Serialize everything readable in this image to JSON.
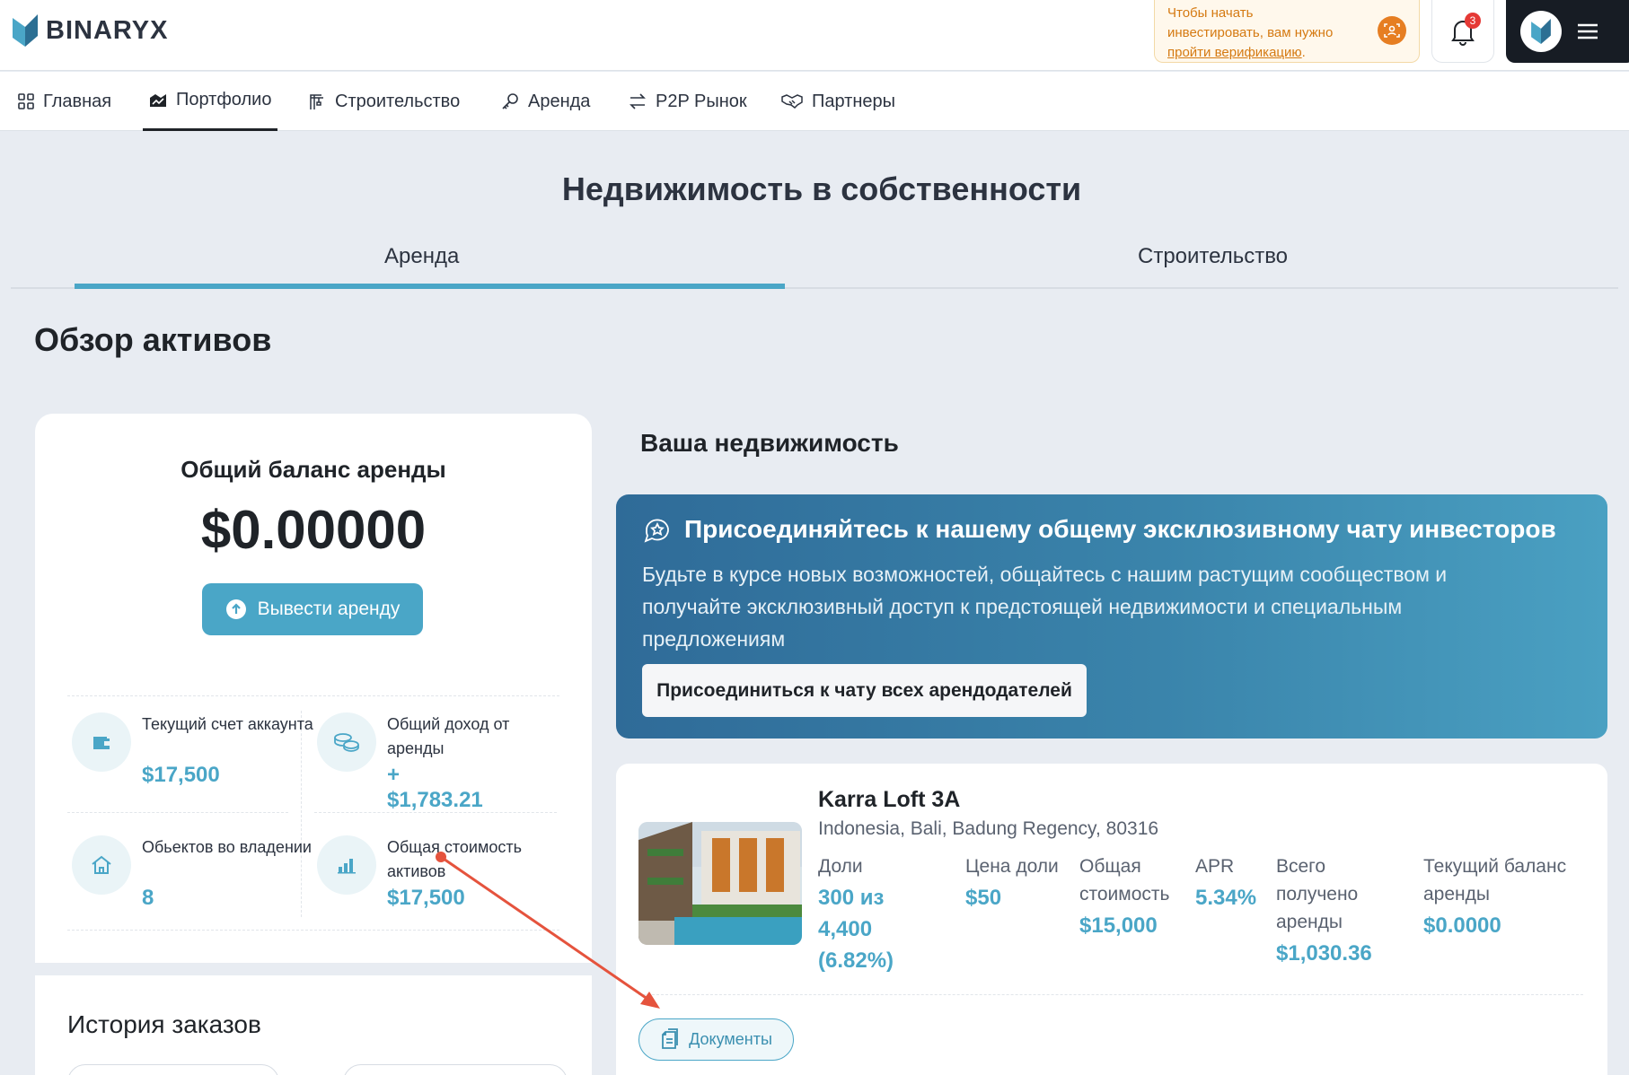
{
  "header": {
    "logo_text": "BINARYX",
    "verify_line1": "Чтобы начать",
    "verify_line2": "инвестировать, вам нужно",
    "verify_link": "пройти верификацию",
    "verify_tail": ".",
    "notifications_count": "3"
  },
  "nav": [
    {
      "label": "Главная",
      "icon": "grid-icon"
    },
    {
      "label": "Портфолио",
      "icon": "chart-icon"
    },
    {
      "label": "Строительство",
      "icon": "crane-icon"
    },
    {
      "label": "Аренда",
      "icon": "key-icon"
    },
    {
      "label": "P2P Рынок",
      "icon": "swap-icon"
    },
    {
      "label": "Партнеры",
      "icon": "handshake-icon"
    }
  ],
  "page": {
    "title": "Недвижимость в собственности",
    "tabs": [
      "Аренда",
      "Строительство"
    ],
    "overview_title": "Обзор активов"
  },
  "balance": {
    "title": "Общий баланс аренды",
    "value": "$0.00000",
    "withdraw_label": "Вывести аренду",
    "stats": [
      {
        "label": "Текущий счет аккаунта",
        "value": "$17,500",
        "icon": "wallet-icon"
      },
      {
        "label": "Общий доход от аренды",
        "value": "+ $1,783.21",
        "icon": "coins-icon"
      },
      {
        "label": "Обьектов во владении",
        "value": "8",
        "icon": "home-icon"
      },
      {
        "label": "Общая стоимость активов",
        "value": "$17,500",
        "icon": "bar-chart-icon"
      }
    ]
  },
  "history": {
    "title": "История заказов"
  },
  "properties": {
    "section_title": "Ваша недвижимость",
    "promo": {
      "title": "Присоединяйтесь к нашему общему эксклюзивному чату инвесторов",
      "text": "Будьте в курсе новых возможностей, общайтесь с нашим растущим сообществом и получайте эксклюзивный доступ к предстоящей недвижимости и специальным предложениям",
      "button": "Присоединиться к чату всех арендодателей"
    },
    "item": {
      "name": "Karra Loft 3A",
      "address": "Indonesia, Bali, Badung Regency, 80316",
      "columns": [
        {
          "header": "Доли",
          "value": "300 из 4,400 (6.82%)"
        },
        {
          "header": "Цена доли",
          "value": "$50"
        },
        {
          "header": "Общая стоимость",
          "value": "$15,000"
        },
        {
          "header": "APR",
          "value": "5.34%"
        },
        {
          "header": "Всего получено аренды",
          "value": "$1,030.36"
        },
        {
          "header": "Текущий баланс аренды",
          "value": "$0.0000"
        }
      ],
      "docs_label": "Документы"
    }
  },
  "colors": {
    "accent": "#4aa6c7",
    "annotation_arrow": "#e5533d",
    "page_bg": "#e8ecf2"
  }
}
